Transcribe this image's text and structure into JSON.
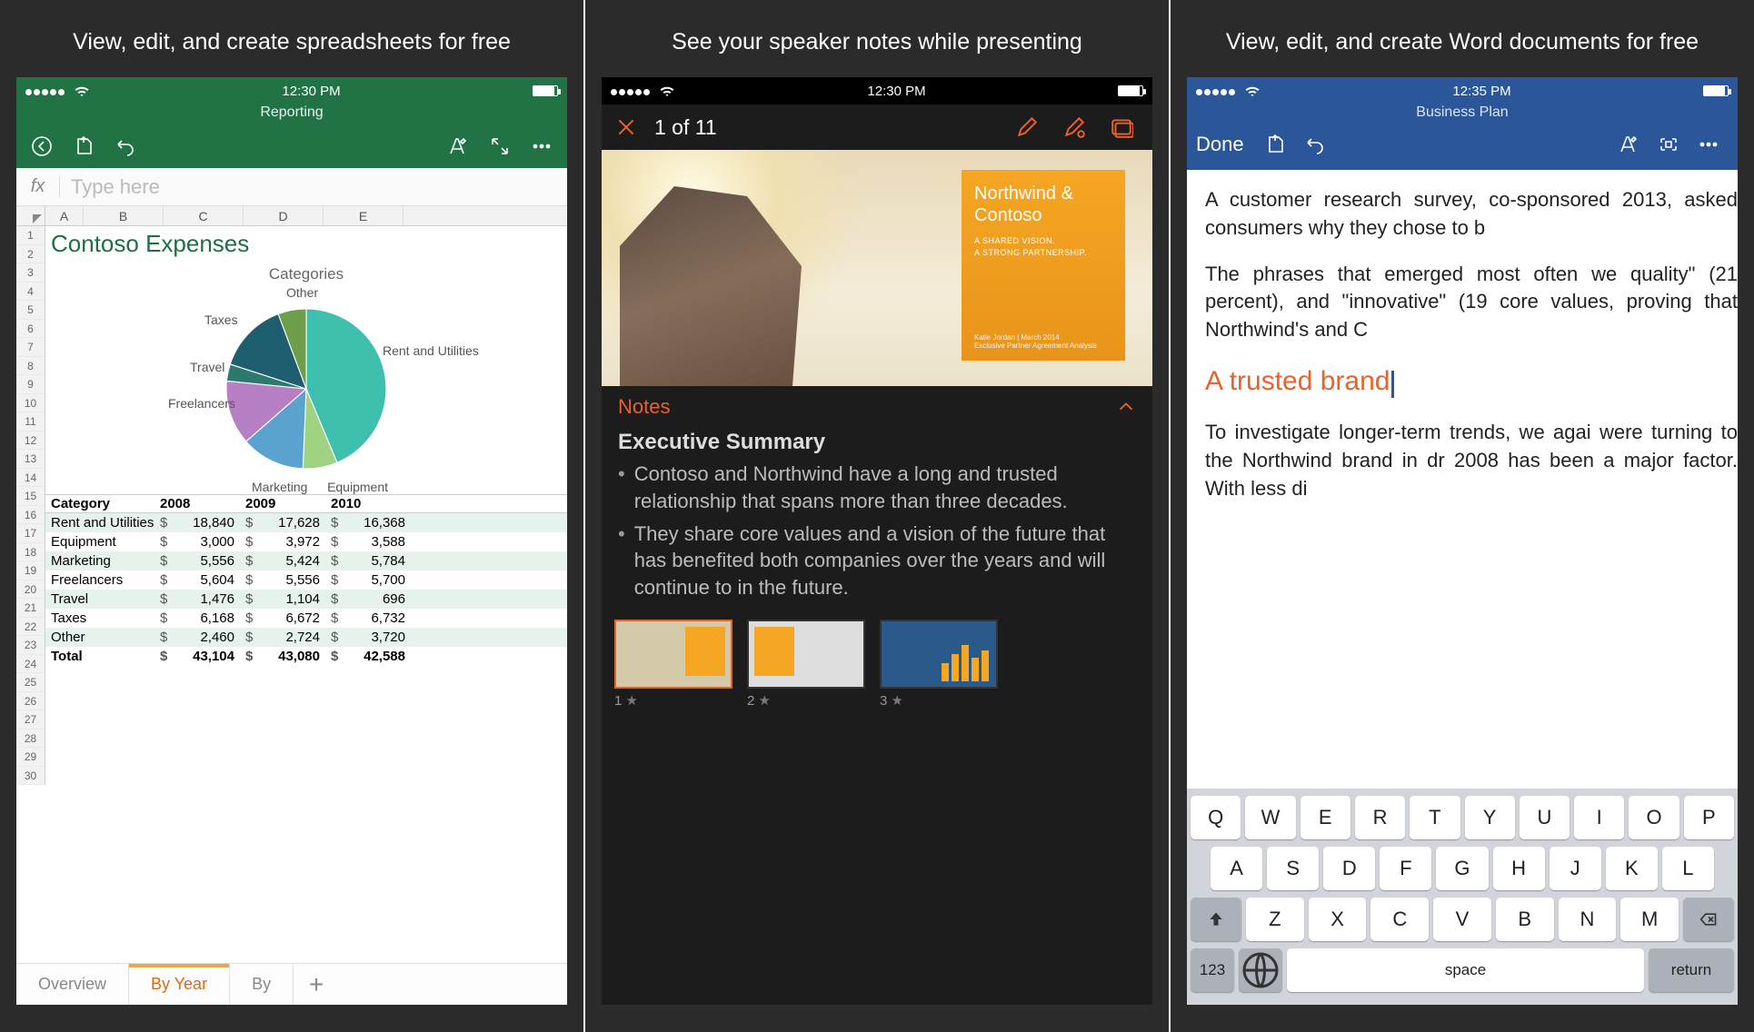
{
  "panel1": {
    "caption": "View, edit, and create spreadsheets for free",
    "time": "12:30 PM",
    "subtitle": "Reporting",
    "fx_placeholder": "Type here",
    "chart_title": "Contoso Expenses",
    "chart_caption": "Categories",
    "col_headers": [
      "A",
      "B",
      "C",
      "D",
      "E"
    ],
    "table_header": [
      "Category",
      "2008",
      "2009",
      "2010"
    ],
    "rows": [
      {
        "label": "Rent and Utilities",
        "v": [
          "18,840",
          "17,628",
          "16,368"
        ]
      },
      {
        "label": "Equipment",
        "v": [
          "3,000",
          "3,972",
          "3,588"
        ]
      },
      {
        "label": "Marketing",
        "v": [
          "5,556",
          "5,424",
          "5,784"
        ]
      },
      {
        "label": "Freelancers",
        "v": [
          "5,604",
          "5,556",
          "5,700"
        ]
      },
      {
        "label": "Travel",
        "v": [
          "1,476",
          "1,104",
          "696"
        ]
      },
      {
        "label": "Taxes",
        "v": [
          "6,168",
          "6,672",
          "6,732"
        ]
      },
      {
        "label": "Other",
        "v": [
          "2,460",
          "2,724",
          "3,720"
        ]
      }
    ],
    "total": {
      "label": "Total",
      "v": [
        "43,104",
        "43,080",
        "42,588"
      ]
    },
    "tabs": [
      "Overview",
      "By Year",
      "By"
    ],
    "active_tab": 1,
    "pie_labels": [
      "Other",
      "Taxes",
      "Travel",
      "Freelancers",
      "Marketing",
      "Equipment",
      "Rent and Utilities"
    ]
  },
  "panel2": {
    "caption": "See your speaker notes while presenting",
    "time": "12:30 PM",
    "counter": "1 of 11",
    "slide_title": "Northwind & Contoso",
    "slide_tag1": "A SHARED VISION.",
    "slide_tag2": "A STRONG PARTNERSHIP.",
    "slide_foot1": "Katie Jordan | March 2014",
    "slide_foot2": "Exclusive Partner Agreement Analysis",
    "notes_label": "Notes",
    "notes_title": "Executive Summary",
    "bullet1": "Contoso and Northwind have a long and trusted relationship that spans more than three decades.",
    "bullet2": "They share core values and a vision of the future that has benefited both companies over the years and will continue to in the future.",
    "thumbs": [
      "1",
      "2",
      "3"
    ]
  },
  "panel3": {
    "caption": "View, edit, and create Word documents for free",
    "time": "12:35 PM",
    "subtitle": "Business Plan",
    "done": "Done",
    "para1": "A customer research survey, co-sponsored 2013, asked consumers why they chose to b",
    "para2": "The phrases that emerged most often we quality\" (21 percent), and \"innovative\" (19 core values, proving that Northwind's and C",
    "heading": "A trusted brand",
    "para3": "To investigate longer-term trends, we agai were turning to the Northwind brand in dr 2008 has been a major factor. With less di",
    "kbd_r1": [
      "Q",
      "W",
      "E",
      "R",
      "T",
      "Y",
      "U",
      "I",
      "O",
      "P"
    ],
    "kbd_r2": [
      "A",
      "S",
      "D",
      "F",
      "G",
      "H",
      "J",
      "K",
      "L"
    ],
    "kbd_r3": [
      "Z",
      "X",
      "C",
      "V",
      "B",
      "N",
      "M"
    ],
    "kbd_123": "123",
    "kbd_space": "space",
    "kbd_return": "return"
  },
  "chart_data": {
    "type": "pie",
    "title": "Contoso Expenses — Categories",
    "series": [
      {
        "name": "2008",
        "values": [
          18840,
          3000,
          5556,
          5604,
          1476,
          6168,
          2460
        ]
      }
    ],
    "categories": [
      "Rent and Utilities",
      "Equipment",
      "Marketing",
      "Freelancers",
      "Travel",
      "Taxes",
      "Other"
    ]
  }
}
